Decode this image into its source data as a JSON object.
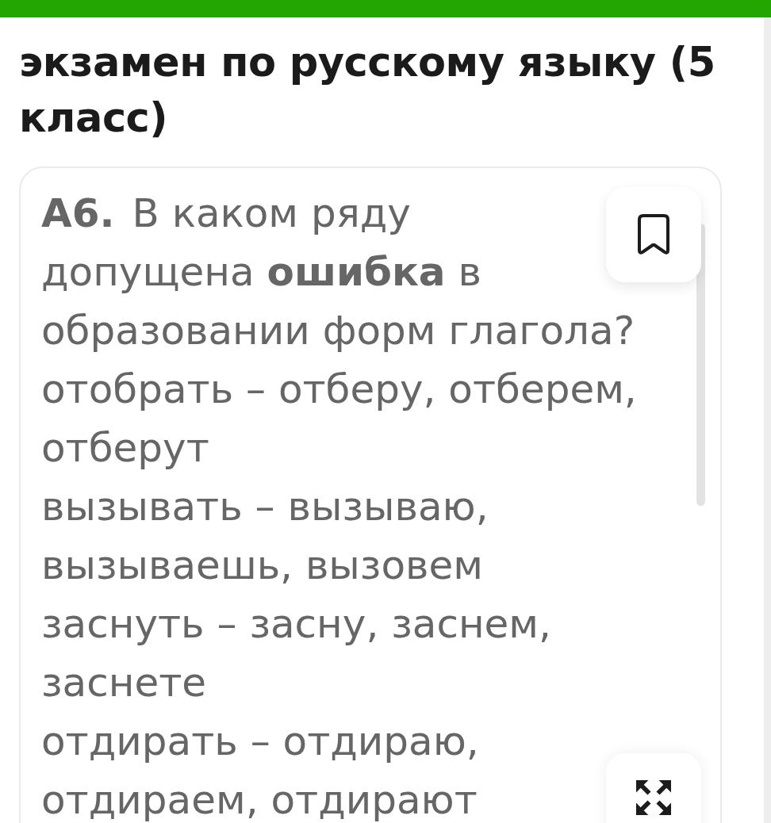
{
  "heading": "экзамен по русскому языку (5 класс)",
  "card": {
    "bookmarked": false,
    "question": {
      "number": "А6.",
      "text": "В каком ряду допущена **ошибка** в образовании форм глагола?"
    },
    "options": [
      "отобрать – отберу, отберем, отберут",
      "вызывать – вызываю, вызываешь, вызовем",
      "заснуть – засну, заснем, заснете",
      "отдирать – отдираю, отдираем, отдирают"
    ]
  }
}
